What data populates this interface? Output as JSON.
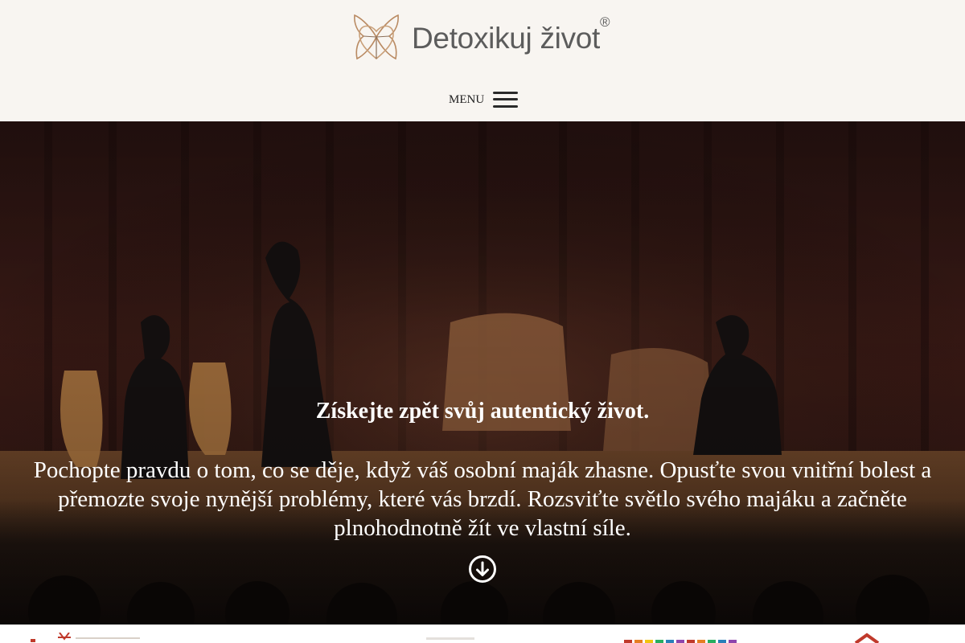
{
  "brand": {
    "name": "Detoxikuj život",
    "registered_mark": "®",
    "accent_color": "#b98a62"
  },
  "nav": {
    "menu_label": "MENU",
    "menu_icon": "hamburger-icon"
  },
  "hero": {
    "title": "Získejte zpět svůj autentický život.",
    "text": "Pochopte pravdu o tom, co se děje, když váš osobní maják zhasne. Opusťte svou vnitřní bolest a přemozte svoje nynější problémy, které vás brzdí. Rozsviťte světlo svého majáku a začněte plnohodnotně žít ve vlastní síle.",
    "scroll_icon": "arrow-down-circle-icon"
  },
  "partners_strip": {
    "logos": [
      "partner-logo-1",
      "partner-logo-2",
      "partner-logo-3",
      "partner-logo-4"
    ]
  }
}
